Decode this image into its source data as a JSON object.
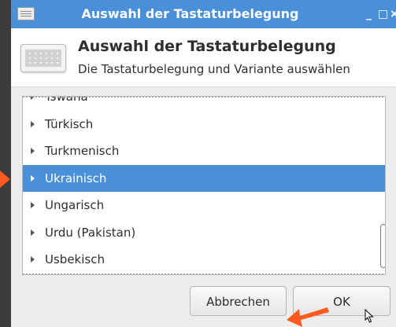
{
  "window": {
    "title": "Auswahl der Tastaturbelegung",
    "controls": {
      "minimize": "_",
      "maximize": "□",
      "close": "×"
    }
  },
  "header": {
    "title": "Auswahl der Tastaturbelegung",
    "subtitle": "Die Tastaturbelegung und Variante auswählen",
    "icon": "keyboard-icon"
  },
  "list": {
    "items": [
      {
        "label": "Tswana",
        "selected": false
      },
      {
        "label": "Türkisch",
        "selected": false
      },
      {
        "label": "Turkmenisch",
        "selected": false
      },
      {
        "label": "Ukrainisch",
        "selected": true
      },
      {
        "label": "Ungarisch",
        "selected": false
      },
      {
        "label": "Urdu (Pakistan)",
        "selected": false
      },
      {
        "label": "Usbekisch",
        "selected": false
      }
    ]
  },
  "buttons": {
    "cancel": "Abbrechen",
    "ok": "OK"
  },
  "colors": {
    "accent": "#4a90d9",
    "annotation_arrow": "#ff5a1f"
  }
}
